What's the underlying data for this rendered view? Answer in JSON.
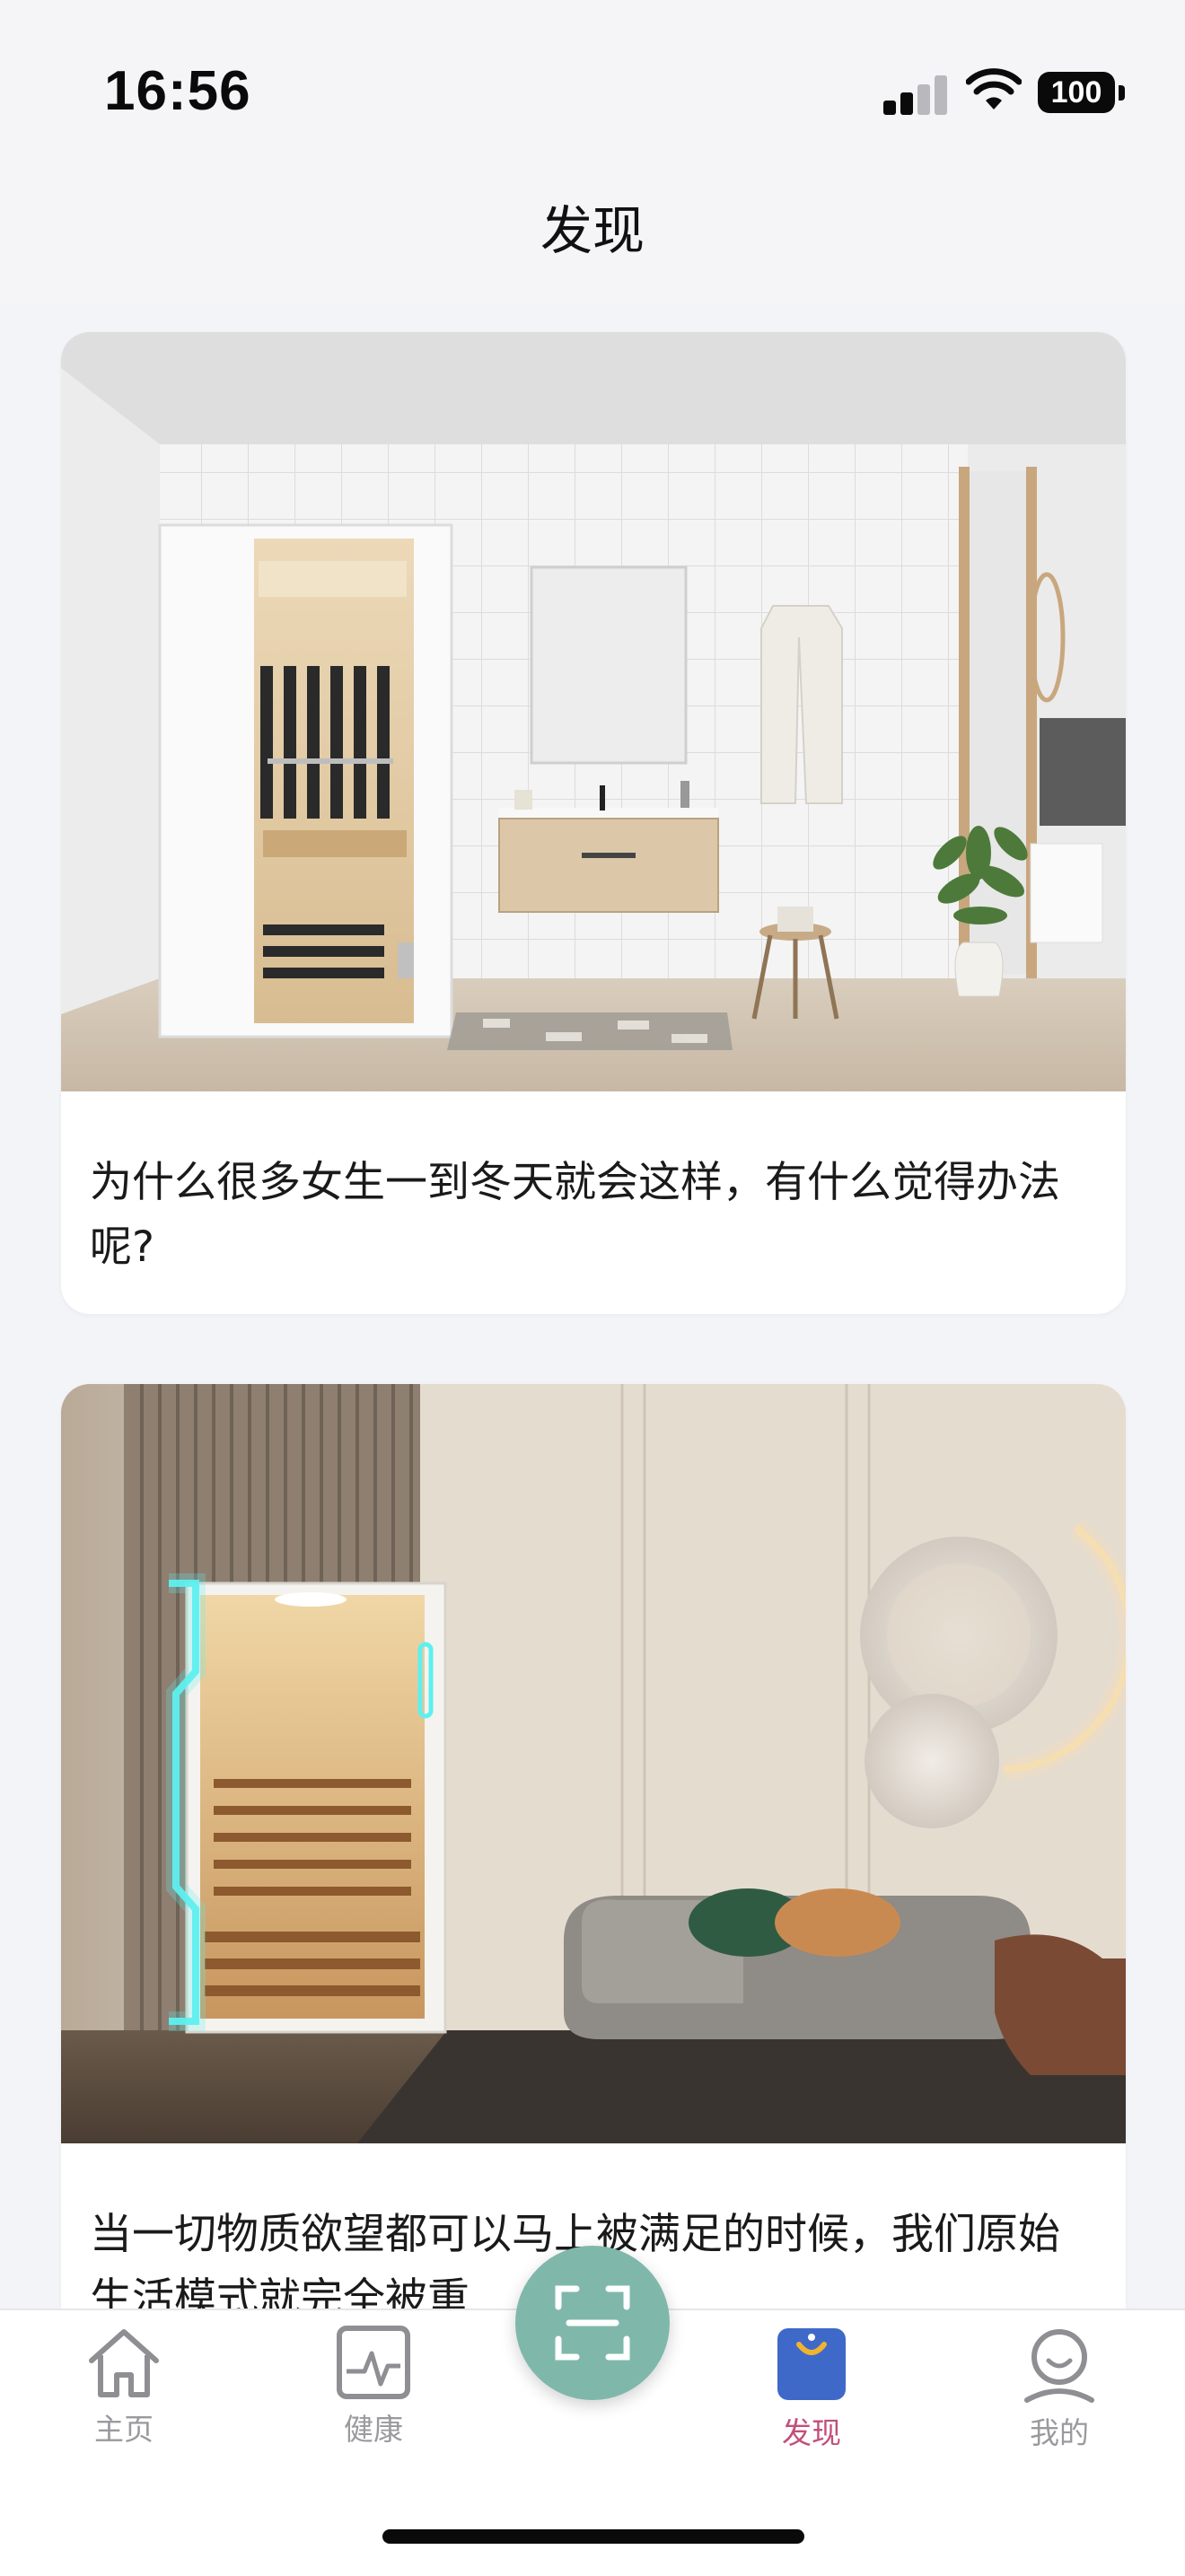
{
  "status_bar": {
    "time": "16:56",
    "battery": "100",
    "icons": [
      "signal-icon",
      "wifi-icon",
      "battery-icon"
    ]
  },
  "header": {
    "title": "发现"
  },
  "articles": [
    {
      "title": "为什么很多女生一到冬天就会这样，有什么觉得办法呢?",
      "image": "bathroom-infrared-sauna-cabin"
    },
    {
      "title": "当一切物质欲望都可以马上被满足的时候，我们原始生活模式就完全被重",
      "image": "living-room-sauna-with-neon-light"
    }
  ],
  "tab_bar": {
    "items": [
      {
        "label": "主页",
        "icon": "home-icon",
        "active": false
      },
      {
        "label": "健康",
        "icon": "health-chart-icon",
        "active": false
      },
      {
        "label": "发现",
        "icon": "shopping-bag-icon",
        "active": true
      },
      {
        "label": "我的",
        "icon": "profile-icon",
        "active": false
      }
    ],
    "center_button_icon": "scan-icon",
    "active_color": "#c2507a",
    "inactive_color": "#9a9a9e",
    "scan_color": "#7fb8ab"
  }
}
